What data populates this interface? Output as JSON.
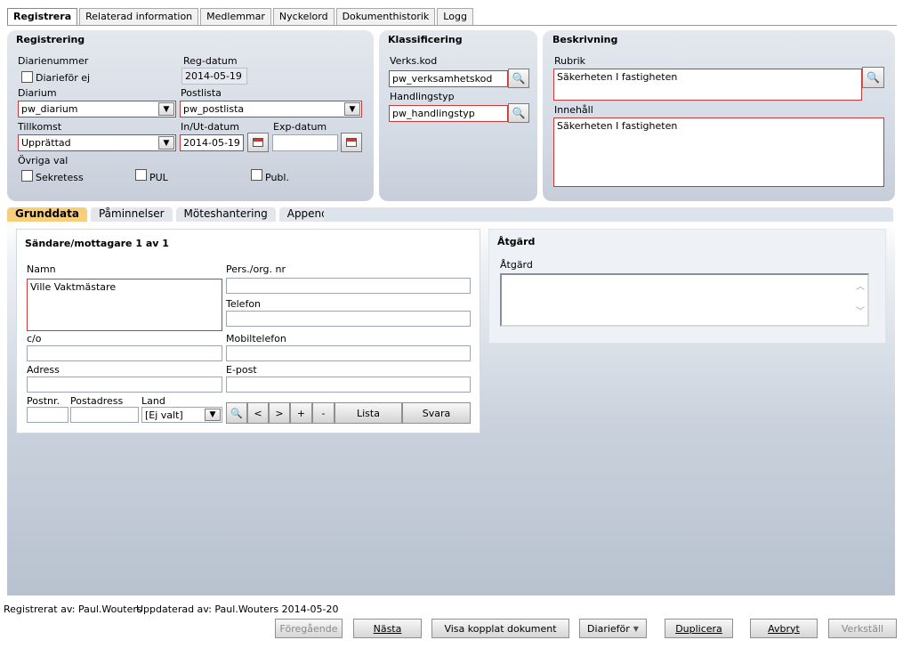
{
  "tabs": [
    "Registrera",
    "Relaterad information",
    "Medlemmar",
    "Nyckelord",
    "Dokumenthistorik",
    "Logg"
  ],
  "registrering": {
    "title": "Registrering",
    "diarienummer_label": "Diarienummer",
    "diarifor_ej_label": "Diarieför ej",
    "regdatum_label": "Reg-datum",
    "regdatum_value": "2014-05-19",
    "diarium_label": "Diarium",
    "diarium_value": "pw_diarium",
    "postlista_label": "Postlista",
    "postlista_value": "pw_postlista",
    "tillkomst_label": "Tillkomst",
    "tillkomst_value": "Upprättad",
    "inut_label": "In/Ut-datum",
    "inut_value": "2014-05-19",
    "exp_label": "Exp-datum",
    "exp_value": "",
    "ovriga_label": "Övriga val",
    "sekretess_label": "Sekretess",
    "pul_label": "PUL",
    "publ_label": "Publ."
  },
  "klassificering": {
    "title": "Klassificering",
    "verks_label": "Verks.kod",
    "verks_value": "pw_verksamhetskod",
    "handling_label": "Handlingstyp",
    "handling_value": "pw_handlingstyp"
  },
  "beskrivning": {
    "title": "Beskrivning",
    "rubrik_label": "Rubrik",
    "rubrik_value": "Säkerheten I fastigheten",
    "innehall_label": "Innehåll",
    "innehall_value": "Säkerheten I fastigheten"
  },
  "subtabs": [
    "Grunddata",
    "Påminnelser",
    "Möteshantering",
    "Appendix"
  ],
  "sender": {
    "title": "Sändare/mottagare 1 av 1",
    "namn_label": "Namn",
    "namn_value": "Ville Vaktmästare",
    "pers_label": "Pers./org. nr",
    "telefon_label": "Telefon",
    "co_label": "c/o",
    "mobil_label": "Mobiltelefon",
    "adress_label": "Adress",
    "epost_label": "E-post",
    "postnr_label": "Postnr.",
    "postadress_label": "Postadress",
    "land_label": "Land",
    "land_value": "[Ej valt]",
    "nav": {
      "prev": "<",
      "next": ">",
      "add": "+",
      "remove": "-",
      "lista": "Lista",
      "svara": "Svara"
    }
  },
  "atgard": {
    "title": "Åtgärd",
    "field_label": "Åtgärd"
  },
  "status": {
    "registrerat": "Registrerat av: Paul.Wouters",
    "uppdaterat": "Uppdaterad av: Paul.Wouters 2014-05-20"
  },
  "buttons": {
    "foregaende": "Föregående",
    "nasta": "Nästa",
    "visa": "Visa kopplat dokument",
    "diarifor": "Diarieför",
    "duplicera": "Duplicera",
    "avbryt": "Avbryt",
    "verkstall": "Verkställ"
  },
  "colors": {
    "active_subtab": "#f8ce7c",
    "required_border": "#c53a3a",
    "panel": "#d4dbe5"
  }
}
